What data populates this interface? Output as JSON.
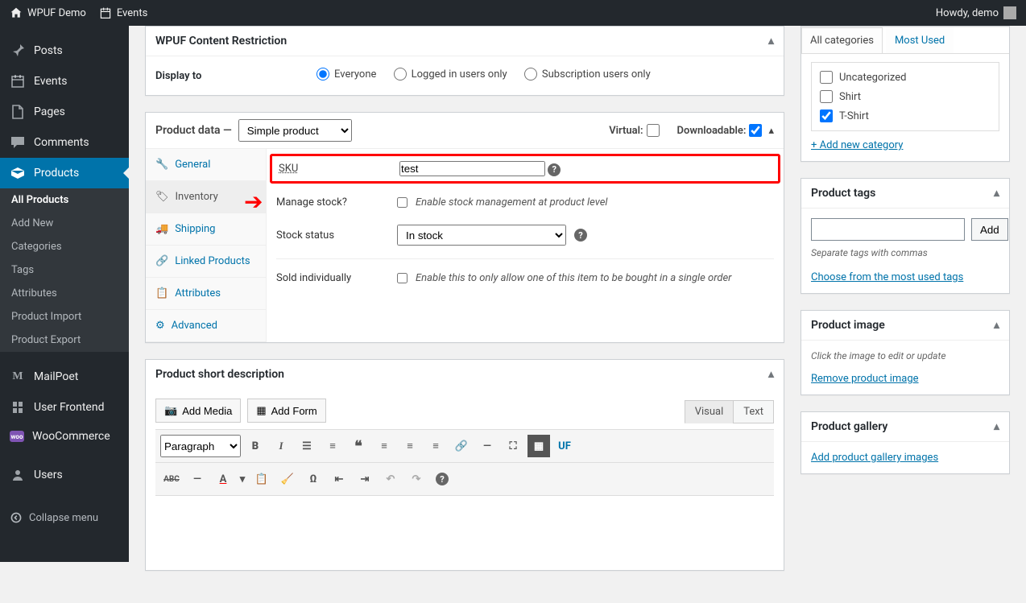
{
  "adminbar": {
    "site_name": "WPUF Demo",
    "events": "Events",
    "howdy": "Howdy, demo"
  },
  "sidebar": {
    "posts": "Posts",
    "events": "Events",
    "pages": "Pages",
    "comments": "Comments",
    "products": "Products",
    "submenu": {
      "all": "All Products",
      "add": "Add New",
      "categories": "Categories",
      "tags": "Tags",
      "attributes": "Attributes",
      "import": "Product Import",
      "export": "Product Export"
    },
    "mailpoet": "MailPoet",
    "user_frontend": "User Frontend",
    "woocommerce": "WooCommerce",
    "users": "Users",
    "collapse": "Collapse menu"
  },
  "restrict": {
    "title": "WPUF Content Restriction",
    "display_to": "Display to",
    "everyone": "Everyone",
    "logged_in": "Logged in users only",
    "subscription": "Subscription users only"
  },
  "product_data": {
    "title_prefix": "Product data —",
    "type": "Simple product",
    "virtual_label": "Virtual:",
    "downloadable_label": "Downloadable:",
    "tabs": {
      "general": "General",
      "inventory": "Inventory",
      "shipping": "Shipping",
      "linked": "Linked Products",
      "attributes": "Attributes",
      "advanced": "Advanced"
    },
    "sku_label": "SKU",
    "sku_value": "test",
    "manage_stock_label": "Manage stock?",
    "manage_stock_hint": "Enable stock management at product level",
    "stock_status_label": "Stock status",
    "stock_status_value": "In stock",
    "sold_individually_label": "Sold individually",
    "sold_individually_hint": "Enable this to only allow one of this item to be bought in a single order"
  },
  "short_desc": {
    "title": "Product short description",
    "add_media": "Add Media",
    "add_form": "Add Form",
    "visual": "Visual",
    "text": "Text",
    "paragraph": "Paragraph"
  },
  "cats": {
    "all": "All categories",
    "most_used": "Most Used",
    "uncategorized": "Uncategorized",
    "shirt": "Shirt",
    "tshirt": "T-Shirt",
    "add_new": "+ Add new category"
  },
  "tags_box": {
    "title": "Product tags",
    "add": "Add",
    "hint": "Separate tags with commas",
    "choose": "Choose from the most used tags"
  },
  "image_box": {
    "title": "Product image",
    "hint": "Click the image to edit or update",
    "remove": "Remove product image"
  },
  "gallery_box": {
    "title": "Product gallery",
    "add": "Add product gallery images"
  }
}
